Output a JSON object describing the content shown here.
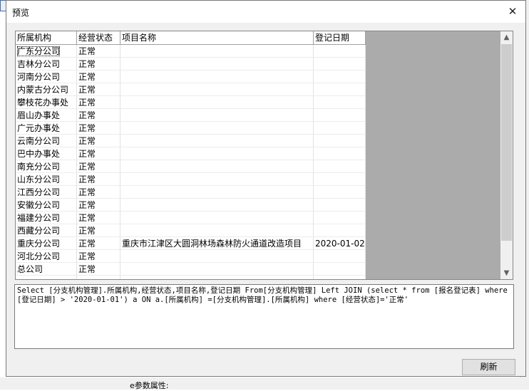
{
  "dialog": {
    "title": "预览",
    "close_glyph": "✕",
    "refresh_label": "刷新"
  },
  "table": {
    "columns": [
      "所属机构",
      "经营状态",
      "项目名称",
      "登记日期"
    ],
    "rows": [
      [
        "广东分公司",
        "正常",
        "",
        ""
      ],
      [
        "吉林分公司",
        "正常",
        "",
        ""
      ],
      [
        "河南分公司",
        "正常",
        "",
        ""
      ],
      [
        "内蒙古分公司",
        "正常",
        "",
        ""
      ],
      [
        "攀枝花办事处",
        "正常",
        "",
        ""
      ],
      [
        "眉山办事处",
        "正常",
        "",
        ""
      ],
      [
        "广元办事处",
        "正常",
        "",
        ""
      ],
      [
        "云南分公司",
        "正常",
        "",
        ""
      ],
      [
        "巴中办事处",
        "正常",
        "",
        ""
      ],
      [
        "南充分公司",
        "正常",
        "",
        ""
      ],
      [
        "山东分公司",
        "正常",
        "",
        ""
      ],
      [
        "江西分公司",
        "正常",
        "",
        ""
      ],
      [
        "安徽分公司",
        "正常",
        "",
        ""
      ],
      [
        "福建分公司",
        "正常",
        "",
        ""
      ],
      [
        "西藏分公司",
        "正常",
        "",
        ""
      ],
      [
        "重庆分公司",
        "正常",
        "重庆市江津区大圆洞林场森林防火通道改造项目",
        "2020-01-02"
      ],
      [
        "河北分公司",
        "正常",
        "",
        ""
      ],
      [
        "总公司",
        "正常",
        "",
        ""
      ],
      [
        "",
        "",
        "",
        ""
      ]
    ],
    "scroll_up": "▲",
    "scroll_down": "▼"
  },
  "sql_text": "Select [分支机构管理].所属机构,经营状态,项目名称,登记日期 From[分支机构管理] Left JOIN (select * from [报名登记表] where [登记日期] > '2020-01-01') a ON a.[所属机构] =[分支机构管理].[所属机构] where [经营状态]='正常'",
  "background": {
    "bottom_text": "e参数属性:"
  }
}
